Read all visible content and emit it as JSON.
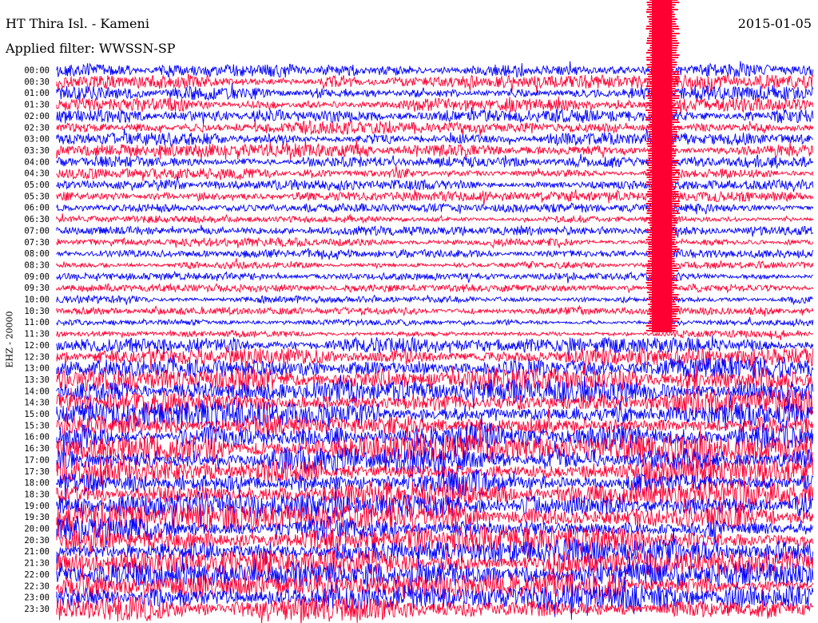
{
  "header": {
    "station": "HT Thira Isl. - Kameni",
    "date": "2015-01-05",
    "filter_label": "Applied filter: WWSSN-SP"
  },
  "chart_data": {
    "type": "line",
    "title": "HT Thira Isl. - Kameni",
    "subtitle": "Applied filter: WWSSN-SP",
    "date": "2015-01-05",
    "ylabel": "EHZ - 20000",
    "xlabel": "",
    "grid": false,
    "tick_labels": [
      "00:00",
      "00:30",
      "01:00",
      "01:30",
      "02:00",
      "02:30",
      "03:00",
      "03:30",
      "04:00",
      "04:30",
      "05:00",
      "05:30",
      "06:00",
      "06:30",
      "07:00",
      "07:30",
      "08:00",
      "08:30",
      "09:00",
      "09:30",
      "10:00",
      "10:30",
      "11:00",
      "11:30",
      "12:00",
      "12:30",
      "13:00",
      "13:30",
      "14:00",
      "14:30",
      "15:00",
      "15:30",
      "16:00",
      "16:30",
      "17:00",
      "17:30",
      "18:00",
      "18:30",
      "19:00",
      "19:30",
      "20:00",
      "20:30",
      "21:00",
      "21:30",
      "22:00",
      "22:30",
      "23:00",
      "23:30"
    ],
    "series_colors": [
      "#0000ff",
      "#ff0033"
    ],
    "color_pattern": "alternating by 30-minute row",
    "xlim_minutes": [
      0,
      30
    ],
    "relative_amplitude": [
      0.55,
      0.55,
      0.55,
      0.55,
      0.55,
      0.55,
      0.52,
      0.52,
      0.45,
      0.42,
      0.42,
      0.42,
      0.35,
      0.3,
      0.35,
      0.35,
      0.32,
      0.3,
      0.3,
      0.32,
      0.32,
      0.3,
      0.25,
      0.3,
      0.6,
      0.7,
      0.85,
      0.9,
      0.95,
      1.0,
      1.0,
      1.0,
      1.1,
      1.1,
      1.1,
      1.1,
      1.1,
      1.1,
      1.1,
      1.1,
      1.1,
      1.1,
      1.0,
      1.0,
      1.0,
      1.0,
      1.0,
      1.0
    ],
    "event": {
      "description": "large clipped signal",
      "start_time": "00:00",
      "end_time": "11:30",
      "offset_minutes": [
        23.6,
        24.4
      ],
      "color": "#ff0033"
    }
  }
}
